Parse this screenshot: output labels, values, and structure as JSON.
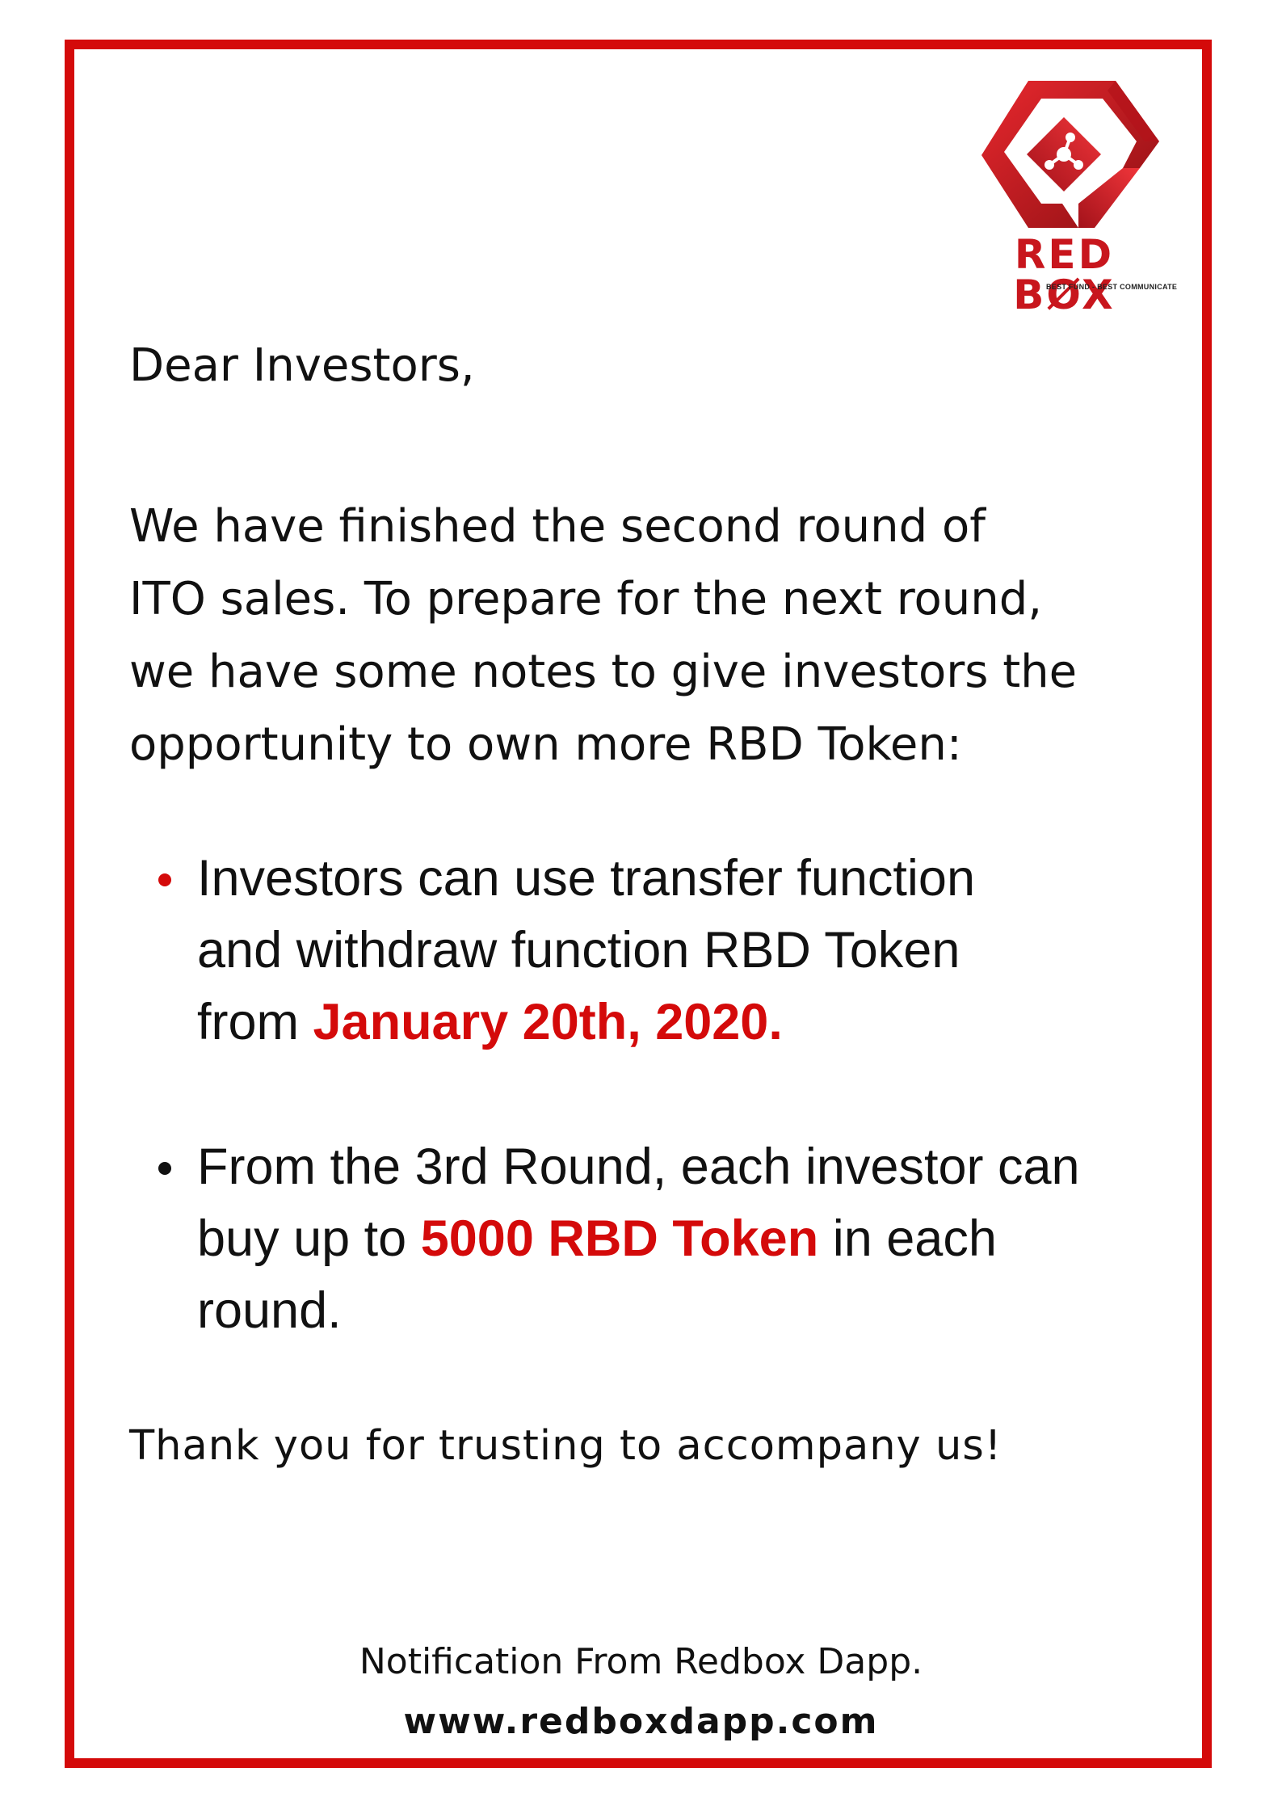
{
  "brand": {
    "name": "RED BØX",
    "tagline": "BEST FUND - BEST COMMUNICATE",
    "color": "#d40a0a",
    "logo_icon": "hexagon-network-icon"
  },
  "letter": {
    "greeting": "Dear Investors,",
    "intro_lines": [
      "We have finished the second round of",
      "ITO sales. To prepare for the next round,",
      "we have some notes to give investors the",
      "opportunity to own more RBD Token:"
    ],
    "notes": [
      {
        "line1": "Investors can use transfer function",
        "line2": "and withdraw function RBD Token",
        "line3_prefix": "from ",
        "highlight": "January 20th, 2020.",
        "line3_suffix": ""
      },
      {
        "line1": "From the 3rd Round, each investor can",
        "line2_prefix": "buy up to ",
        "highlight": "5000 RBD Token",
        "line2_suffix": " in each",
        "line3": "round."
      }
    ],
    "closing": "Thank you for trusting to accompany us!"
  },
  "footer": {
    "note": "Notification From Redbox Dapp.",
    "url": "www.redboxdapp.com"
  }
}
